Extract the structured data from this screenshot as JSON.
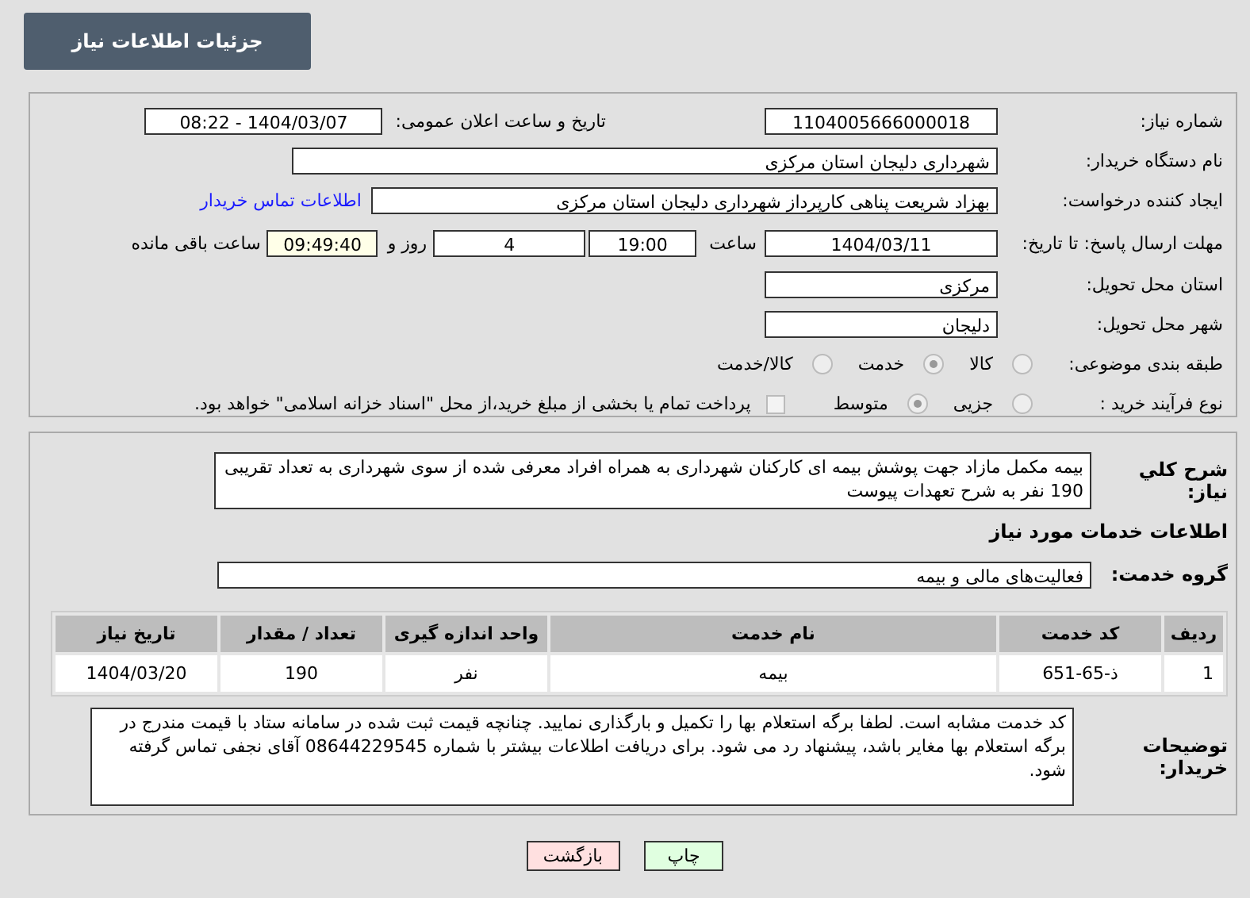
{
  "title": "جزئیات اطلاعات نیاز",
  "need_number": {
    "label": "شماره نیاز:",
    "value": "1104005666000018"
  },
  "announce": {
    "label": "تاریخ و ساعت اعلان عمومی:",
    "value": "1404/03/07 - 08:22"
  },
  "buyer_org": {
    "label": "نام دستگاه خریدار:",
    "value": "شهرداری دلیجان استان مرکزی"
  },
  "requester": {
    "label": "ایجاد کننده درخواست:",
    "value": "بهزاد شریعت پناهی کارپرداز شهرداری دلیجان استان مرکزی",
    "link": "اطلاعات تماس خریدار"
  },
  "deadline": {
    "label": "مهلت ارسال پاسخ: تا تاریخ:",
    "date": "1404/03/11",
    "time_label": "ساعت",
    "time": "19:00",
    "days": "4",
    "days_label": "روز و",
    "remaining": "09:49:40",
    "remaining_label": "ساعت باقی مانده"
  },
  "province": {
    "label": "استان محل تحویل:",
    "value": "مرکزی"
  },
  "city": {
    "label": "شهر محل تحویل:",
    "value": "دلیجان"
  },
  "category": {
    "label": "طبقه بندی موضوعی:",
    "options": [
      {
        "label": "کالا",
        "selected": false
      },
      {
        "label": "خدمت",
        "selected": true
      },
      {
        "label": "کالا/خدمت",
        "selected": false
      }
    ]
  },
  "process": {
    "label": "نوع فرآیند خرید :",
    "options": [
      {
        "label": "جزیی",
        "selected": false
      },
      {
        "label": "متوسط",
        "selected": true
      }
    ],
    "payment": {
      "label": "پرداخت تمام یا بخشی از مبلغ خرید،از محل \"اسناد خزانه اسلامی\" خواهد بود.",
      "checked": false
    }
  },
  "description": {
    "label": "شرح کلي نياز:",
    "value": "بیمه مکمل مازاد جهت پوشش بیمه ای کارکنان شهرداری به همراه افراد معرفی شده از سوی شهرداری به تعداد تقریبی 190 نفر به شرح تعهدات پیوست"
  },
  "services_heading": "اطلاعات خدمات مورد نیاز",
  "service_group": {
    "label": "گروه خدمت:",
    "value": "فعالیت‌های مالی و بیمه"
  },
  "table": {
    "columns": [
      "ردیف",
      "کد خدمت",
      "نام خدمت",
      "واحد اندازه گیری",
      "تعداد / مقدار",
      "تاریخ نیاز"
    ],
    "rows": [
      [
        "1",
        "ذ-65-651",
        "بیمه",
        "نفر",
        "190",
        "1404/03/20"
      ]
    ]
  },
  "buyer_notes": {
    "label": "توضیحات خریدار:",
    "value": "کد خدمت مشابه است. لطفا برگه استعلام بها را تکمیل و بارگذاری نمایید. چنانچه قیمت ثبت شده در سامانه ستاد با قیمت مندرج در برگه استعلام بها مغایر باشد، پیشنهاد رد می شود. برای دریافت اطلاعات بیشتر با شماره 08644229545 آقای نجفی تماس گرفته شود."
  },
  "buttons": [
    {
      "label": "چاپ",
      "kind": "print"
    },
    {
      "label": "بازگشت",
      "kind": "back"
    }
  ]
}
